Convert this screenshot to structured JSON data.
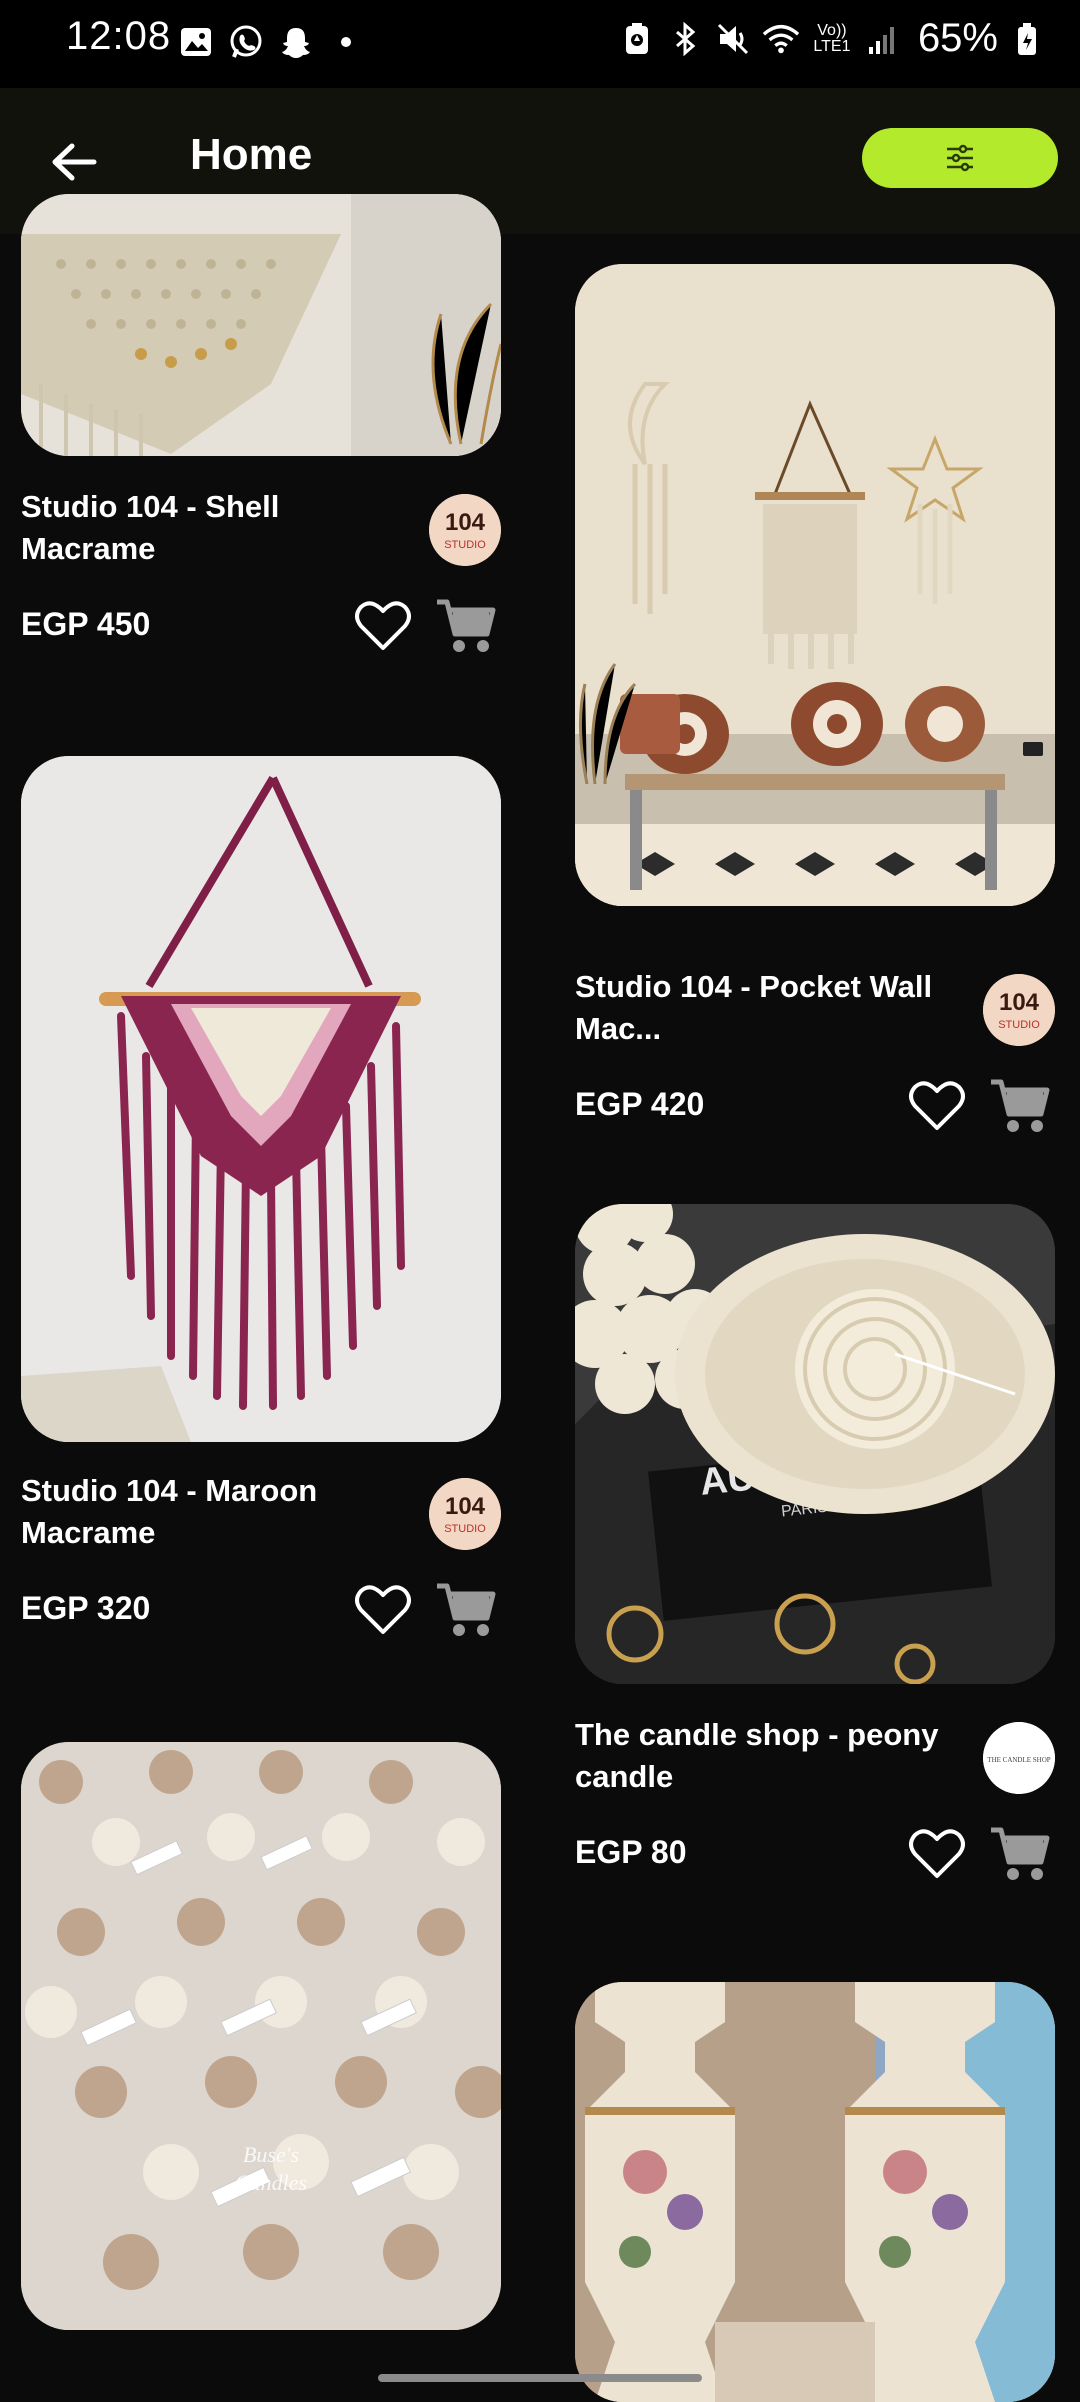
{
  "status_bar": {
    "time": "12:08",
    "battery": "65%",
    "volte_top": "Vo))",
    "volte_bottom": "LTE1",
    "left_icons": [
      "gallery-icon",
      "whatsapp-icon",
      "snapchat-icon",
      "dot-icon"
    ],
    "right_icons": [
      "battery-saver-icon",
      "bluetooth-icon",
      "mute-icon",
      "wifi-icon",
      "volte-icon",
      "signal-icon",
      "battery-icon"
    ]
  },
  "app_bar": {
    "title": "Home",
    "back_icon": "arrow-left-icon",
    "filter_icon": "sliders-icon",
    "accent": "#b3ea2b"
  },
  "products_left": [
    {
      "name": "Studio 104 - Shell Macrame",
      "price": "EGP 450",
      "seller_logo_text": "104 STUDIO",
      "image": "shell macrame"
    },
    {
      "name": "Studio 104 - Maroon Macrame",
      "price": "EGP 320",
      "seller_logo_text": "104 STUDIO",
      "image": "maroon macrame"
    },
    {
      "image": "bubble candles"
    }
  ],
  "products_right": [
    {
      "name": "Studio 104 - Pocket Wall Mac...",
      "price": "EGP 420",
      "seller_logo_text": "104 STUDIO",
      "image": "pocket wall macrame"
    },
    {
      "name": "The candle shop - peony candle",
      "price": "EGP 80",
      "seller_logo_text": "THE CANDLE SHOP",
      "image": "peony candle"
    },
    {
      "image": "porcelain candle holders"
    }
  ],
  "image_captions": {
    "candles_watermark_1": "Buse's",
    "candles_watermark_2": "Candles",
    "peony_box_text": "AUDEPART",
    "peony_box_sub": "PARIS"
  }
}
